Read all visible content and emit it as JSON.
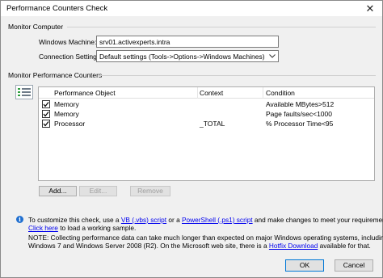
{
  "window": {
    "title": "Performance Counters Check",
    "close_glyph": "✕"
  },
  "monitor_computer": {
    "group_label": "Monitor Computer",
    "windows_machine_label": "Windows Machine:",
    "windows_machine_value": "srv01.activexperts.intra",
    "connection_settings_label": "Connection Settings:",
    "connection_settings_value": "Default settings  (Tools->Options->Windows Machines)"
  },
  "monitor_counters": {
    "group_label": "Monitor Performance Counters",
    "columns": [
      "Performance Object",
      "Context",
      "Condition"
    ],
    "rows": [
      {
        "checked": true,
        "object": "Memory",
        "context": "",
        "condition": "Available MBytes>512"
      },
      {
        "checked": true,
        "object": "Memory",
        "context": "",
        "condition": "Page faults/sec<1000"
      },
      {
        "checked": true,
        "object": "Processor",
        "context": "_TOTAL",
        "condition": "% Processor Time<95"
      }
    ],
    "add_label": "Add...",
    "edit_label": "Edit...",
    "remove_label": "Remove"
  },
  "info": {
    "icon": "info-icon",
    "line1_pre": "To customize this check, use a ",
    "line1_link1": "VB (.vbs) script",
    "line1_mid": " or a ",
    "line1_link2": "PowerShell (.ps1) script",
    "line1_post": " and make changes to meet your requirements.",
    "line2_link": "Click here",
    "line2_post": " to load a working sample.",
    "note_line1": "NOTE: Collecting performance data can take much longer than expected on major Windows operating systems, including",
    "note_line2_pre": "Windows 7 and Windows Server 2008 (R2). On the Microsoft web site, there is a ",
    "note_line2_link": "Hotfix Download",
    "note_line2_post": " available for that."
  },
  "footer": {
    "ok_label": "OK",
    "cancel_label": "Cancel"
  }
}
